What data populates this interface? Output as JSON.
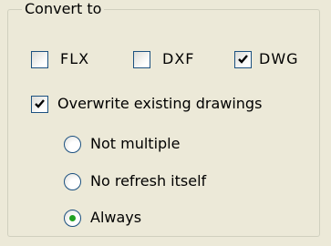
{
  "group": {
    "title": "Convert to",
    "formats": [
      {
        "label": "FLX",
        "checked": false
      },
      {
        "label": "DXF",
        "checked": false
      },
      {
        "label": "DWG",
        "checked": true
      }
    ],
    "overwrite": {
      "label": "Overwrite existing drawings",
      "checked": true
    },
    "options": [
      {
        "label": "Not multiple",
        "selected": false
      },
      {
        "label": "No refresh itself",
        "selected": false
      },
      {
        "label": "Always",
        "selected": true
      }
    ]
  },
  "colors": {
    "background": "#ece9d8",
    "control_border": "#1c5180",
    "radio_dot": "#21a121"
  }
}
